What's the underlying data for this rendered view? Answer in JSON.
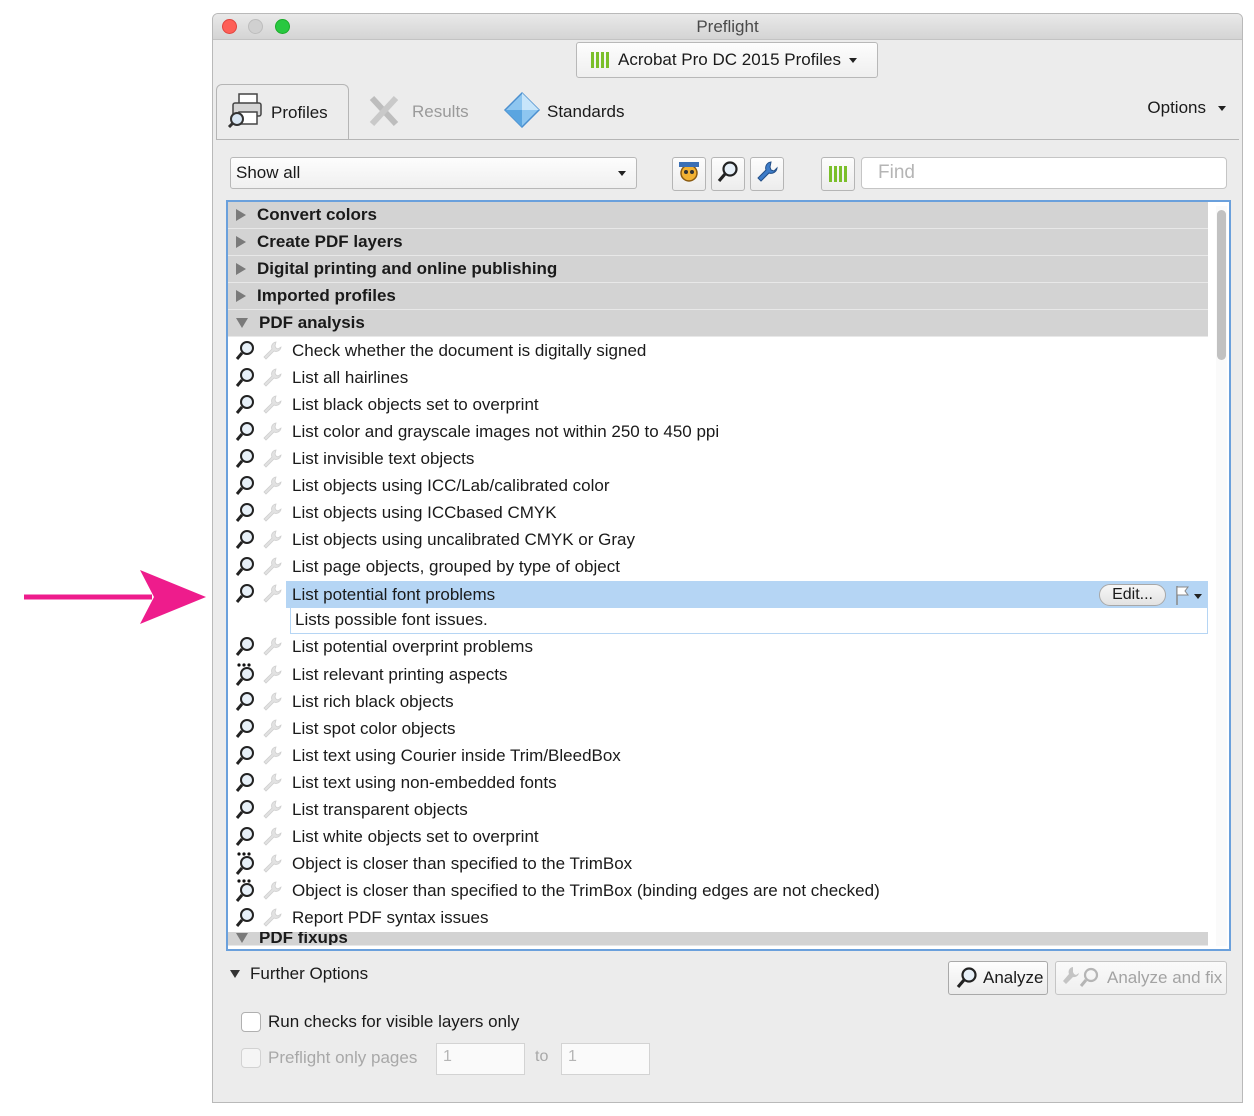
{
  "window": {
    "title": "Preflight"
  },
  "library_select": {
    "value": "Acrobat Pro DC 2015 Profiles"
  },
  "tabs": [
    {
      "label": "Profiles",
      "icon": "profiles-icon",
      "active": true
    },
    {
      "label": "Results",
      "icon": "results-icon",
      "active": false
    },
    {
      "label": "Standards",
      "icon": "standards-icon",
      "active": false
    }
  ],
  "options": {
    "label": "Options"
  },
  "filter": {
    "value": "Show all"
  },
  "toolbar": {
    "find_placeholder": "Find"
  },
  "categories": [
    {
      "label": "Convert colors",
      "expanded": false
    },
    {
      "label": "Create PDF layers",
      "expanded": false
    },
    {
      "label": "Digital printing and online publishing",
      "expanded": false
    },
    {
      "label": "Imported profiles",
      "expanded": false
    },
    {
      "label": "PDF analysis",
      "expanded": true
    },
    {
      "label": "PDF fixups",
      "expanded": true
    }
  ],
  "profiles": [
    "Check whether the document is digitally signed",
    "List all hairlines",
    "List black objects set to overprint",
    "List color and grayscale images not within 250 to 450 ppi",
    "List invisible text objects",
    "List objects using ICC/Lab/calibrated color",
    "List objects using ICCbased CMYK",
    "List objects using uncalibrated CMYK or Gray",
    "List page objects, grouped by type of object",
    "List potential font problems",
    "List potential overprint problems",
    "List relevant printing aspects",
    "List rich black objects",
    "List spot color objects",
    "List text using Courier inside Trim/BleedBox",
    "List text using non-embedded fonts",
    "List transparent objects",
    "List white objects set to overprint",
    "Object is closer than specified to the TrimBox",
    "Object is closer than specified to the TrimBox (binding edges are not checked)",
    "Report PDF syntax issues"
  ],
  "selected": {
    "index": 9,
    "description": "Lists possible font issues.",
    "edit_label": "Edit..."
  },
  "further_options": {
    "label": "Further Options"
  },
  "buttons": {
    "analyze": "Analyze",
    "analyze_fix": "Analyze and fix"
  },
  "checks": {
    "visible_layers": "Run checks for visible layers only",
    "only_pages": "Preflight only pages",
    "from": "1",
    "to_label": "to",
    "to": "1"
  },
  "colors": {
    "annotation_arrow": "#ee1c8c",
    "selection": "#b5d5f4",
    "list_border": "#6aa0dc"
  }
}
